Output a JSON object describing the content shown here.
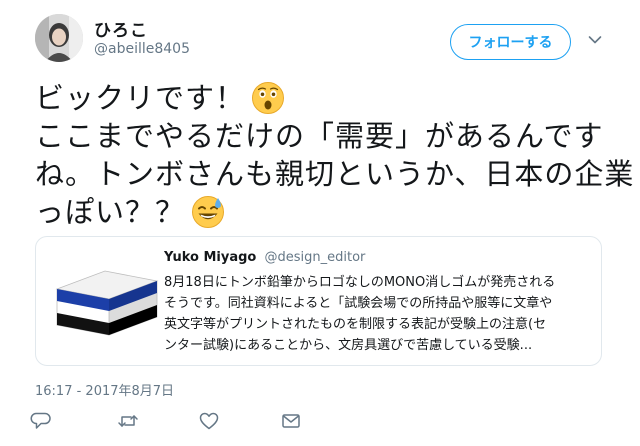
{
  "user": {
    "display_name": "ひろこ",
    "handle": "@abeille8405"
  },
  "follow_button_label": "フォローする",
  "tweet": {
    "lines": [
      "ビックリです！",
      "ここまでやるだけの「需要」があるんです",
      "ね。トンボさんも親切というか、日本の企業",
      "っぽい？？"
    ],
    "emojis": [
      "astonished-face",
      "grinning-face-with-sweat"
    ]
  },
  "quote": {
    "author_name": "Yuko Miyago",
    "author_handle": "@design_editor",
    "lines": [
      "8月18日にトンボ鉛筆からロゴなしのMONO消しゴムが発売される",
      "そうです。同社資料によると「試験会場での所持品や服等に文章や",
      "英文字等がプリントされたものを制限する表記が受験上の注意(セ",
      "ンター試験)にあることから、文房具選びで苦慮している受験..."
    ],
    "image": "logo-less-mono-eraser",
    "image_colors": [
      "#1c3fa8",
      "#ffffff",
      "#111111"
    ]
  },
  "timestamp": "16:17 - 2017年8月7日",
  "actions": [
    "reply-icon",
    "retweet-icon",
    "like-icon",
    "direct-message-icon"
  ],
  "colors": {
    "accent": "#1da1f2",
    "secondary_text": "#657786",
    "border": "#e1e8ed"
  }
}
